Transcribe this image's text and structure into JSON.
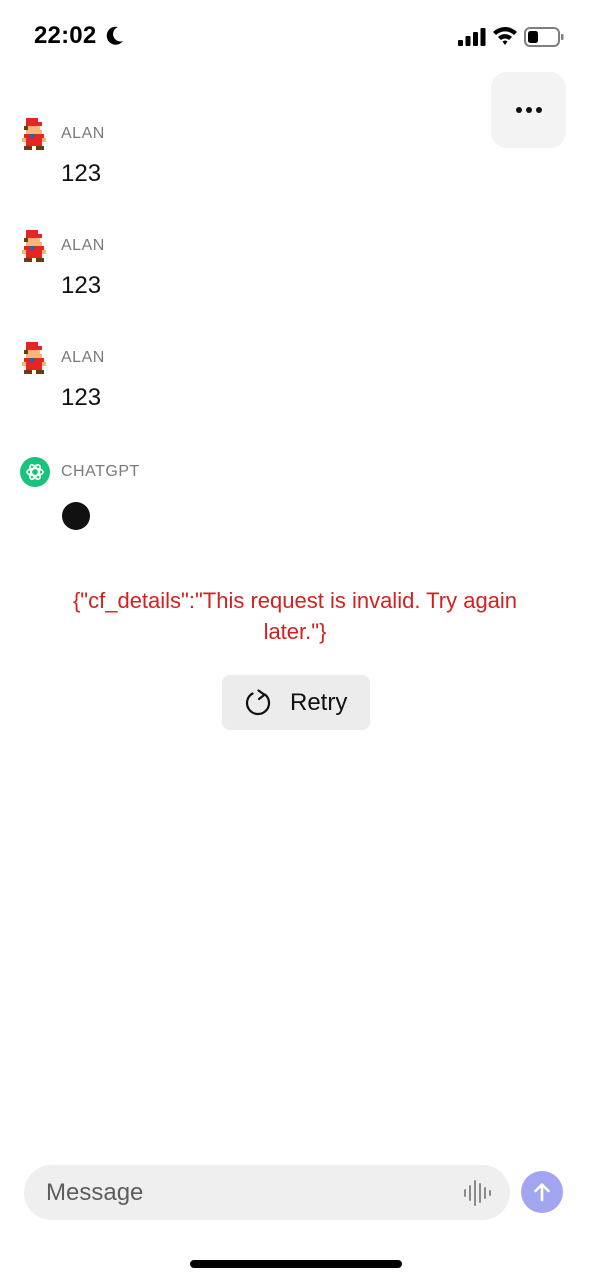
{
  "status_bar": {
    "time": "22:02"
  },
  "header": {
    "more_icon": "ellipsis-icon"
  },
  "messages": [
    {
      "author": "ALAN",
      "text": "123",
      "avatar": "mario-avatar"
    },
    {
      "author": "ALAN",
      "text": "123",
      "avatar": "mario-avatar"
    },
    {
      "author": "ALAN",
      "text": "123",
      "avatar": "mario-avatar"
    },
    {
      "author": "CHATGPT",
      "avatar": "openai-logo-icon",
      "status": "typing"
    }
  ],
  "error": {
    "message": "{\"cf_details\":\"This request is invalid. Try again later.\"}"
  },
  "retry": {
    "label": "Retry"
  },
  "composer": {
    "placeholder": "Message"
  },
  "colors": {
    "error": "#d42020",
    "gpt_green": "#19c37d",
    "send_button": "#a2a5f0"
  }
}
